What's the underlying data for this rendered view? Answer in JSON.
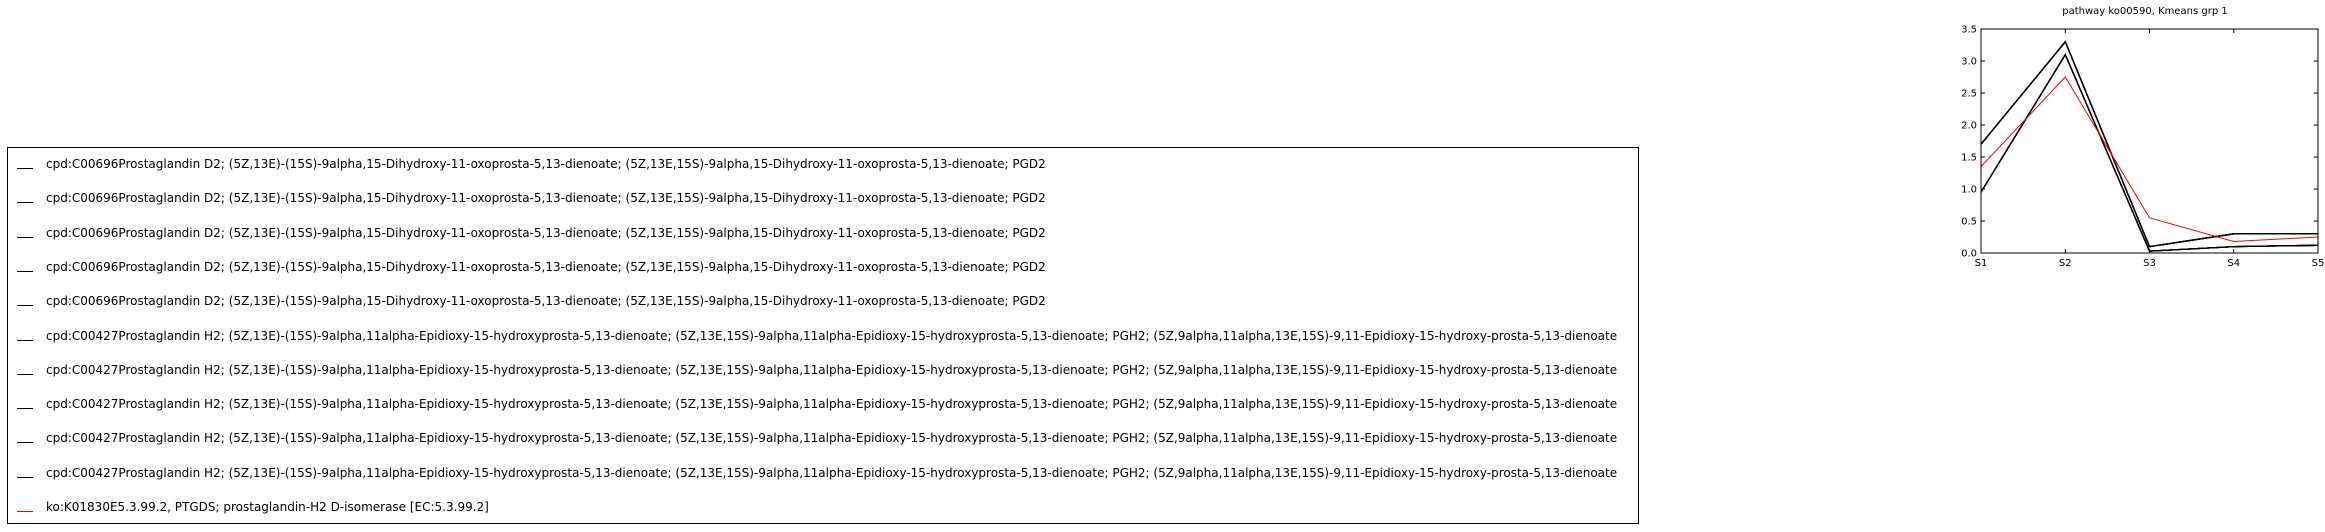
{
  "chart_data": {
    "type": "line",
    "title": "pathway ko00590, Kmeans grp 1",
    "xlabel": "",
    "ylabel": "",
    "categories": [
      "S1",
      "S2",
      "S3",
      "S4",
      "S5"
    ],
    "ylim": [
      0.0,
      3.5
    ],
    "yticks": [
      "0.0",
      "0.5",
      "1.0",
      "1.5",
      "2.0",
      "2.5",
      "3.0",
      "3.5"
    ],
    "grid": false,
    "legend_position": "left, outside the axes",
    "series": [
      {
        "name": "cpd:C00696\u0001Prostaglandin D2; (5Z,13E)-(15S)-9alpha,15-Dihydroxy-11-oxoprosta-5,13-dienoate; (5Z,13E,15S)-9alpha,15-Dihydroxy-11-oxoprosta-5,13-dienoate; PGD2",
        "color": "#000000",
        "values": [
          1.7,
          3.3,
          0.1,
          0.3,
          0.3
        ]
      },
      {
        "name": "cpd:C00696\u0001Prostaglandin D2; (5Z,13E)-(15S)-9alpha,15-Dihydroxy-11-oxoprosta-5,13-dienoate; (5Z,13E,15S)-9alpha,15-Dihydroxy-11-oxoprosta-5,13-dienoate; PGD2",
        "color": "#000000",
        "values": [
          1.7,
          3.3,
          0.1,
          0.3,
          0.3
        ]
      },
      {
        "name": "cpd:C00696\u0001Prostaglandin D2; (5Z,13E)-(15S)-9alpha,15-Dihydroxy-11-oxoprosta-5,13-dienoate; (5Z,13E,15S)-9alpha,15-Dihydroxy-11-oxoprosta-5,13-dienoate; PGD2",
        "color": "#000000",
        "values": [
          1.7,
          3.3,
          0.1,
          0.3,
          0.3
        ]
      },
      {
        "name": "cpd:C00696\u0001Prostaglandin D2; (5Z,13E)-(15S)-9alpha,15-Dihydroxy-11-oxoprosta-5,13-dienoate; (5Z,13E,15S)-9alpha,15-Dihydroxy-11-oxoprosta-5,13-dienoate; PGD2",
        "color": "#000000",
        "values": [
          1.7,
          3.3,
          0.1,
          0.3,
          0.3
        ]
      },
      {
        "name": "cpd:C00696\u0001Prostaglandin D2; (5Z,13E)-(15S)-9alpha,15-Dihydroxy-11-oxoprosta-5,13-dienoate; (5Z,13E,15S)-9alpha,15-Dihydroxy-11-oxoprosta-5,13-dienoate; PGD2",
        "color": "#000000",
        "values": [
          1.7,
          3.3,
          0.1,
          0.3,
          0.3
        ]
      },
      {
        "name": "cpd:C00427\u0001Prostaglandin H2; (5Z,13E)-(15S)-9alpha,11alpha-Epidioxy-15-hydroxyprosta-5,13-dienoate; (5Z,13E,15S)-9alpha,11alpha-Epidioxy-15-hydroxyprosta-5,13-dienoate; PGH2; (5Z,9alpha,11alpha,13E,15S)-9,11-Epidioxy-15-hydroxy-prosta-5,13-dienoate",
        "color": "#000000",
        "values": [
          0.95,
          3.1,
          0.03,
          0.1,
          0.12
        ]
      },
      {
        "name": "cpd:C00427\u0001Prostaglandin H2; (5Z,13E)-(15S)-9alpha,11alpha-Epidioxy-15-hydroxyprosta-5,13-dienoate; (5Z,13E,15S)-9alpha,11alpha-Epidioxy-15-hydroxyprosta-5,13-dienoate; PGH2; (5Z,9alpha,11alpha,13E,15S)-9,11-Epidioxy-15-hydroxy-prosta-5,13-dienoate",
        "color": "#000000",
        "values": [
          0.95,
          3.1,
          0.03,
          0.1,
          0.12
        ]
      },
      {
        "name": "cpd:C00427\u0001Prostaglandin H2; (5Z,13E)-(15S)-9alpha,11alpha-Epidioxy-15-hydroxyprosta-5,13-dienoate; (5Z,13E,15S)-9alpha,11alpha-Epidioxy-15-hydroxyprosta-5,13-dienoate; PGH2; (5Z,9alpha,11alpha,13E,15S)-9,11-Epidioxy-15-hydroxy-prosta-5,13-dienoate",
        "color": "#000000",
        "values": [
          0.95,
          3.1,
          0.03,
          0.1,
          0.12
        ]
      },
      {
        "name": "cpd:C00427\u0001Prostaglandin H2; (5Z,13E)-(15S)-9alpha,11alpha-Epidioxy-15-hydroxyprosta-5,13-dienoate; (5Z,13E,15S)-9alpha,11alpha-Epidioxy-15-hydroxyprosta-5,13-dienoate; PGH2; (5Z,9alpha,11alpha,13E,15S)-9,11-Epidioxy-15-hydroxy-prosta-5,13-dienoate",
        "color": "#000000",
        "values": [
          0.95,
          3.1,
          0.03,
          0.1,
          0.12
        ]
      },
      {
        "name": "cpd:C00427\u0001Prostaglandin H2; (5Z,13E)-(15S)-9alpha,11alpha-Epidioxy-15-hydroxyprosta-5,13-dienoate; (5Z,13E,15S)-9alpha,11alpha-Epidioxy-15-hydroxyprosta-5,13-dienoate; PGH2; (5Z,9alpha,11alpha,13E,15S)-9,11-Epidioxy-15-hydroxy-prosta-5,13-dienoate",
        "color": "#000000",
        "values": [
          0.95,
          3.1,
          0.03,
          0.1,
          0.12
        ]
      },
      {
        "name": "ko:K01830\u0001E5.3.99.2, PTGDS; prostaglandin-H2 D-isomerase [EC:5.3.99.2]",
        "color": "#ff0000",
        "values": [
          1.35,
          2.75,
          0.55,
          0.18,
          0.25
        ]
      }
    ]
  }
}
